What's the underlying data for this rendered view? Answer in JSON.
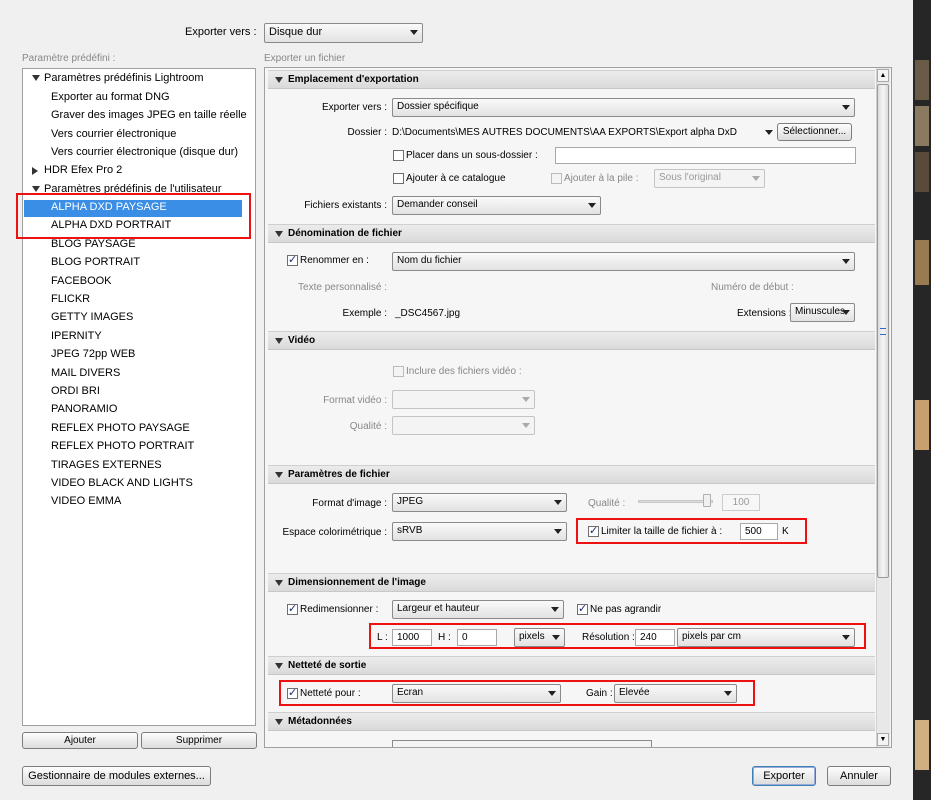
{
  "top": {
    "export_to_label": "Exporter vers :",
    "export_to_value": "Disque dur"
  },
  "left": {
    "title": "Paramètre prédéfini :",
    "group_lightroom": "Paramètres prédéfinis Lightroom",
    "lightroom_items": [
      "Exporter au format DNG",
      "Graver des images JPEG en taille réelle",
      "Vers courrier électronique",
      "Vers courrier électronique (disque dur)"
    ],
    "group_hdr": "HDR Efex Pro 2",
    "group_user": "Paramètres prédéfinis de l'utilisateur",
    "user_items": [
      "ALPHA DXD PAYSAGE",
      "ALPHA DXD PORTRAIT",
      "BLOG PAYSAGE",
      "BLOG PORTRAIT",
      "FACEBOOK",
      "FLICKR",
      "GETTY IMAGES",
      "IPERNITY",
      "JPEG 72pp WEB",
      "MAIL DIVERS",
      "ORDI BRI",
      "PANORAMIO",
      "REFLEX PHOTO PAYSAGE",
      "REFLEX PHOTO PORTRAIT",
      "TIRAGES EXTERNES",
      "VIDEO BLACK AND LIGHTS",
      "VIDEO EMMA"
    ],
    "add_button": "Ajouter",
    "remove_button": "Supprimer"
  },
  "right": {
    "title": "Exporter un fichier",
    "location": {
      "header": "Emplacement d'exportation",
      "export_to_label": "Exporter vers :",
      "export_to_value": "Dossier spécifique",
      "folder_label": "Dossier :",
      "folder_value": "D:\\Documents\\MES AUTRES DOCUMENTS\\AA  EXPORTS\\Export alpha DxD",
      "choose_button": "Sélectionner...",
      "subfolder_label": "Placer dans un sous-dossier :",
      "add_catalog_label": "Ajouter à ce catalogue",
      "add_stack_label": "Ajouter à la pile :",
      "stack_value": "Sous l'original",
      "existing_label": "Fichiers existants :",
      "existing_value": "Demander conseil"
    },
    "naming": {
      "header": "Dénomination de fichier",
      "rename_label": "Renommer en :",
      "rename_value": "Nom du fichier",
      "custom_text_label": "Texte personnalisé :",
      "start_number_label": "Numéro de début :",
      "example_label": "Exemple :",
      "example_value": "_DSC4567.jpg",
      "extensions_label": "Extensions :",
      "extensions_value": "Minuscules"
    },
    "video": {
      "header": "Vidéo",
      "include_label": "Inclure des fichiers vidéo :",
      "format_label": "Format vidéo :",
      "quality_label": "Qualité :"
    },
    "file": {
      "header": "Paramètres de fichier",
      "format_label": "Format d'image :",
      "format_value": "JPEG",
      "quality_label": "Qualité :",
      "quality_value": "100",
      "colorspace_label": "Espace colorimétrique :",
      "colorspace_value": "sRVB",
      "limit_label": "Limiter la taille de fichier à :",
      "limit_value": "500",
      "limit_unit": "K"
    },
    "sizing": {
      "header": "Dimensionnement de l'image",
      "resize_label": "Redimensionner :",
      "resize_value": "Largeur et hauteur",
      "no_enlarge_label": "Ne pas agrandir",
      "w_label": "L :",
      "w_value": "1000",
      "h_label": "H :",
      "h_value": "0",
      "unit_value": "pixels",
      "resolution_label": "Résolution :",
      "resolution_value": "240",
      "resolution_unit": "pixels par cm"
    },
    "sharpen": {
      "header": "Netteté de sortie",
      "sharpen_label": "Netteté pour :",
      "sharpen_value": "Ecran",
      "amount_label": "Gain :",
      "amount_value": "Elevée"
    },
    "metadata": {
      "header": "Métadonnées"
    }
  },
  "bottom": {
    "plugins_button": "Gestionnaire de modules externes...",
    "export_button": "Exporter",
    "cancel_button": "Annuler"
  }
}
